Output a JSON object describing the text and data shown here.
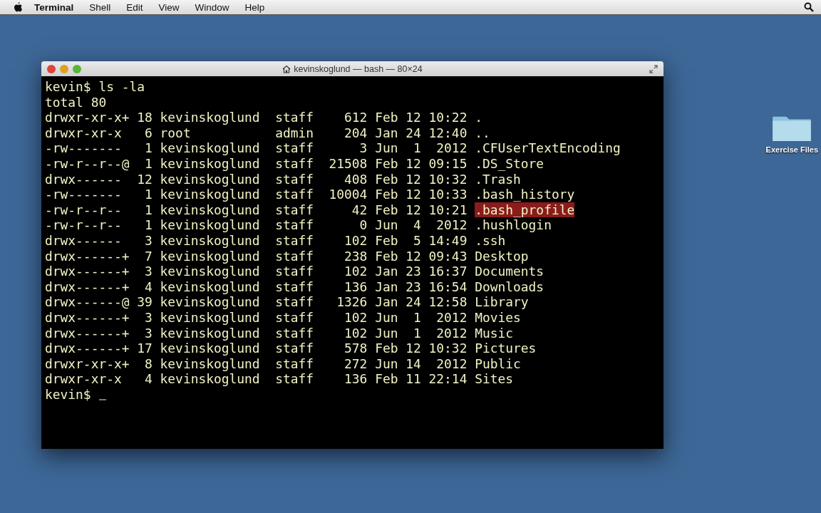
{
  "menu_bar": {
    "app_name": "Terminal",
    "items": [
      "Shell",
      "Edit",
      "View",
      "Window",
      "Help"
    ]
  },
  "window": {
    "title": "kevinskoglund — bash — 80×24"
  },
  "terminal": {
    "command_line": "kevin$ ls -la",
    "summary": "total 80",
    "entries": [
      {
        "details": "drwxr-xr-x+ 18 kevinskoglund  staff    612 Feb 12 10:22 ",
        "name": ".",
        "selected": false
      },
      {
        "details": "drwxr-xr-x   6 root           admin    204 Jan 24 12:40 ",
        "name": "..",
        "selected": false
      },
      {
        "details": "-rw-------   1 kevinskoglund  staff      3 Jun  1  2012 ",
        "name": ".CFUserTextEncoding",
        "selected": false
      },
      {
        "details": "-rw-r--r--@  1 kevinskoglund  staff  21508 Feb 12 09:15 ",
        "name": ".DS_Store",
        "selected": false
      },
      {
        "details": "drwx------  12 kevinskoglund  staff    408 Feb 12 10:32 ",
        "name": ".Trash",
        "selected": false
      },
      {
        "details": "-rw-------   1 kevinskoglund  staff  10004 Feb 12 10:33 ",
        "name": ".bash_history",
        "selected": false
      },
      {
        "details": "-rw-r--r--   1 kevinskoglund  staff     42 Feb 12 10:21 ",
        "name": ".bash_profile",
        "selected": true
      },
      {
        "details": "-rw-r--r--   1 kevinskoglund  staff      0 Jun  4  2012 ",
        "name": ".hushlogin",
        "selected": false
      },
      {
        "details": "drwx------   3 kevinskoglund  staff    102 Feb  5 14:49 ",
        "name": ".ssh",
        "selected": false
      },
      {
        "details": "drwx------+  7 kevinskoglund  staff    238 Feb 12 09:43 ",
        "name": "Desktop",
        "selected": false
      },
      {
        "details": "drwx------+  3 kevinskoglund  staff    102 Jan 23 16:37 ",
        "name": "Documents",
        "selected": false
      },
      {
        "details": "drwx------+  4 kevinskoglund  staff    136 Jan 23 16:54 ",
        "name": "Downloads",
        "selected": false
      },
      {
        "details": "drwx------@ 39 kevinskoglund  staff   1326 Jan 24 12:58 ",
        "name": "Library",
        "selected": false
      },
      {
        "details": "drwx------+  3 kevinskoglund  staff    102 Jun  1  2012 ",
        "name": "Movies",
        "selected": false
      },
      {
        "details": "drwx------+  3 kevinskoglund  staff    102 Jun  1  2012 ",
        "name": "Music",
        "selected": false
      },
      {
        "details": "drwx------+ 17 kevinskoglund  staff    578 Feb 12 10:32 ",
        "name": "Pictures",
        "selected": false
      },
      {
        "details": "drwxr-xr-x+  8 kevinskoglund  staff    272 Jun 14  2012 ",
        "name": "Public",
        "selected": false
      },
      {
        "details": "drwxr-xr-x   4 kevinskoglund  staff    136 Feb 11 22:14 ",
        "name": "Sites",
        "selected": false
      }
    ],
    "prompt": "kevin$"
  },
  "desktop_icons": [
    {
      "label": "Exercise Files"
    }
  ]
}
